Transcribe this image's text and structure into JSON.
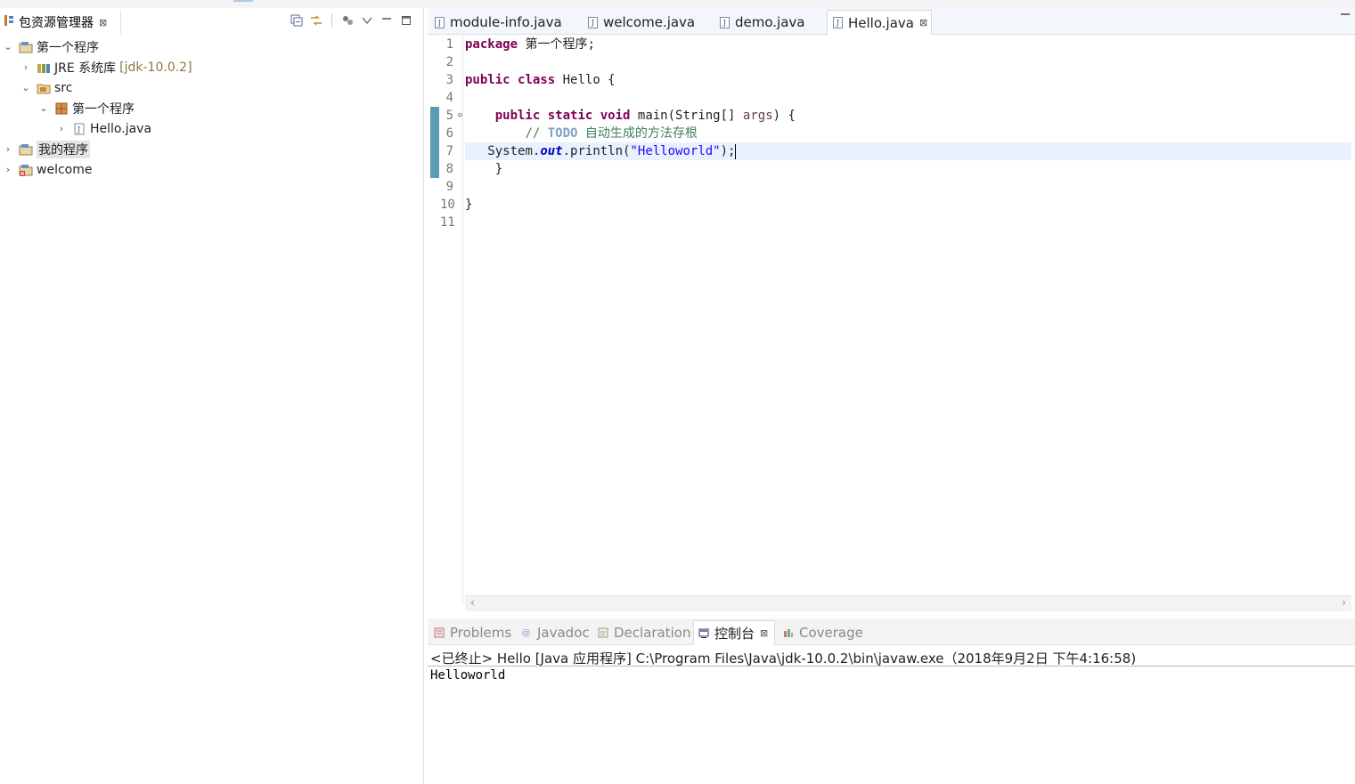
{
  "package_explorer": {
    "tab_label": "包资源管理器",
    "close_glyph": "⊠",
    "tree": [
      {
        "label": "第一个程序",
        "expanded": true,
        "icon": "java-project-icon"
      },
      {
        "label": "JRE 系统库",
        "suffix": "[jdk-10.0.2]",
        "expanded": false,
        "icon": "library-icon"
      },
      {
        "label": "src",
        "expanded": true,
        "icon": "source-folder-icon"
      },
      {
        "label": "第一个程序",
        "expanded": true,
        "icon": "package-icon"
      },
      {
        "label": "Hello.java",
        "expanded": false,
        "icon": "java-file-icon"
      },
      {
        "label": "我的程序",
        "expanded": false,
        "icon": "java-project-icon",
        "selected": true
      },
      {
        "label": "welcome",
        "expanded": false,
        "icon": "java-project-error-icon"
      }
    ]
  },
  "editor": {
    "tabs": [
      {
        "label": "module-info.java",
        "active": false
      },
      {
        "label": "welcome.java",
        "active": false
      },
      {
        "label": "demo.java",
        "active": false
      },
      {
        "label": "Hello.java",
        "active": true
      }
    ],
    "line_numbers": [
      "1",
      "2",
      "3",
      "4",
      "5",
      "6",
      "7",
      "8",
      "9",
      "10",
      "11"
    ],
    "code": {
      "l1_kw": "package",
      "l1_rest": " 第一个程序;",
      "l3_kw1": "public",
      "l3_kw2": "class",
      "l3_rest": " Hello {",
      "l5_kw1": "public",
      "l5_kw2": "static",
      "l5_kw3": "void",
      "l5_mid": " main(String[] ",
      "l5_arg": "args",
      "l5_end": ") {",
      "l6_cm": "// ",
      "l6_todo": "TODO",
      "l6_rest": " 自动生成的方法存根",
      "l7_a": "System.",
      "l7_fld": "out",
      "l7_b": ".println(",
      "l7_str": "\"Helloworld\"",
      "l7_c": ");",
      "l8": "}",
      "l10": "}"
    }
  },
  "console": {
    "tabs": [
      {
        "label": "Problems",
        "active": false
      },
      {
        "label": "Javadoc",
        "active": false
      },
      {
        "label": "Declaration",
        "active": false
      },
      {
        "label": "控制台",
        "active": true
      },
      {
        "label": "Coverage",
        "active": false
      }
    ],
    "status": "<已终止> Hello [Java 应用程序] C:\\Program Files\\Java\\jdk-10.0.2\\bin\\javaw.exe（2018年9月2日 下午4:16:58)",
    "output": "Helloworld"
  }
}
